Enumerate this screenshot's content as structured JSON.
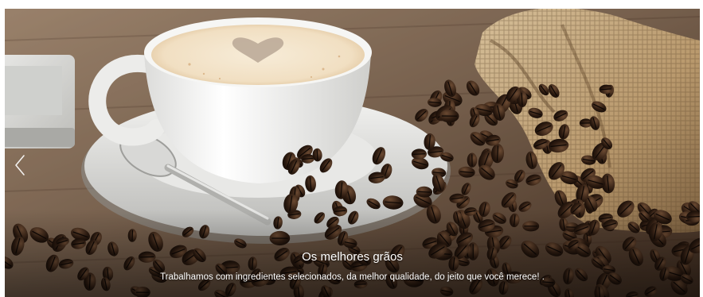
{
  "carousel": {
    "slide": {
      "image": "coffee-cup-and-coffee-beans-photo",
      "title": "Os melhores grãos",
      "text": "Trabalhamos com ingredientes selecionados, da melhor qualidade, do jeito que você merece! ."
    },
    "prev_icon": "chevron-left-icon",
    "colors": {
      "caption_text": "#ffffff",
      "wood": "#8a6e55",
      "cup": "#f4f4f2",
      "beans": "#2b1a10",
      "burlap": "#c9b08a"
    }
  }
}
